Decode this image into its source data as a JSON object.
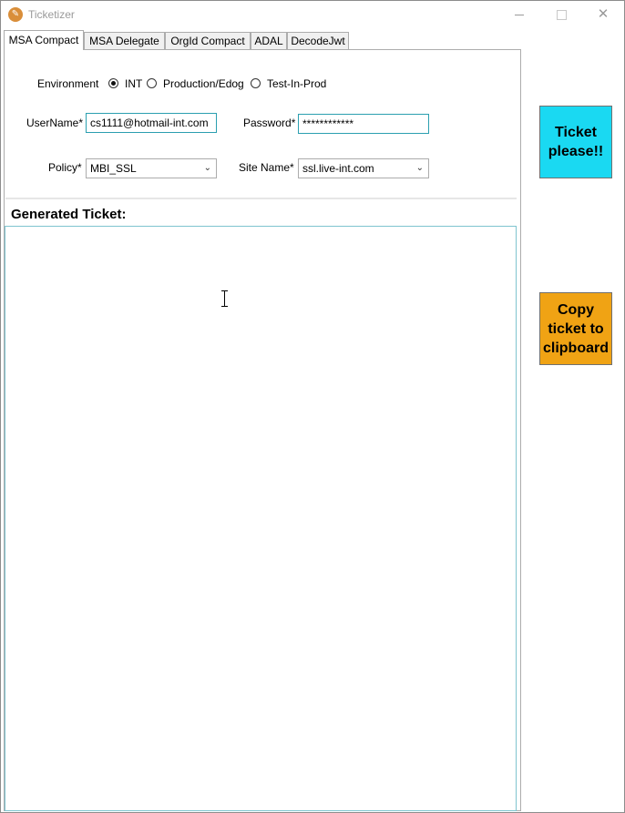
{
  "window": {
    "title": "Ticketizer"
  },
  "tabs": [
    {
      "label": "MSA Compact",
      "active": true
    },
    {
      "label": "MSA Delegate",
      "active": false
    },
    {
      "label": "OrgId Compact",
      "active": false
    },
    {
      "label": "ADAL",
      "active": false
    },
    {
      "label": "DecodeJwt",
      "active": false
    }
  ],
  "form": {
    "environment": {
      "label": "Environment",
      "options": [
        {
          "label": "INT",
          "selected": true
        },
        {
          "label": "Production/Edog",
          "selected": false
        },
        {
          "label": "Test-In-Prod",
          "selected": false
        }
      ]
    },
    "username": {
      "label": "UserName*",
      "value": "cs1111@hotmail-int.com"
    },
    "password": {
      "label": "Password*",
      "value": "************"
    },
    "policy": {
      "label": "Policy*",
      "value": "MBI_SSL"
    },
    "site_name": {
      "label": "Site Name*",
      "value": "ssl.live-int.com"
    }
  },
  "output": {
    "heading": "Generated Ticket:",
    "value": ""
  },
  "buttons": {
    "ticket": "Ticket please!!",
    "copy": "Copy ticket to clipboard"
  },
  "colors": {
    "ticket_button": "#1ad9f2",
    "copy_button": "#f0a314",
    "focus_border": "#2b9fb0"
  }
}
